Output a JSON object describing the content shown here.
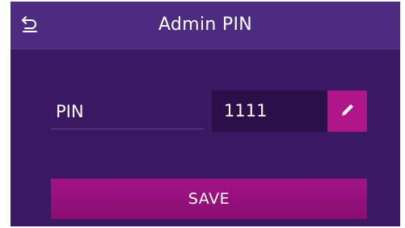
{
  "header": {
    "title": "Admin PIN",
    "back_icon": "back-arrow-icon"
  },
  "form": {
    "pin_label": "PIN",
    "pin_value": "1111",
    "edit_icon": "pencil-icon"
  },
  "actions": {
    "save_label": "SAVE"
  },
  "colors": {
    "background": "#3a1862",
    "header": "#4c2b80",
    "field": "#2a0f48",
    "accent": "#b0168a"
  }
}
